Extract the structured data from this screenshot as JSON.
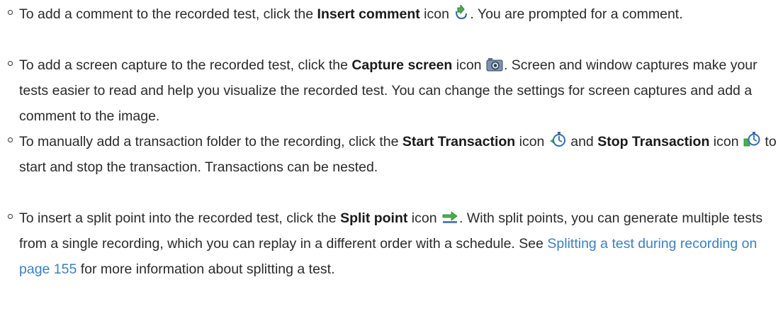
{
  "items": [
    {
      "pre": "To add a comment to the recorded test, click the ",
      "bold": "Insert comment",
      "mid": " icon",
      "icon": "insert-comment-icon",
      "post": ". You are prompted for a comment."
    },
    {
      "pre": "To add a screen capture to the recorded test, click the ",
      "bold": "Capture screen",
      "mid": " icon",
      "icon": "capture-screen-icon",
      "post": ". Screen and window captures make your tests easier to read and help you visualize the recorded test. You can change the settings for screen captures and add a comment to the image."
    },
    {
      "pre": "To manually add a transaction folder to the recording, click the ",
      "bold": "Start Transaction",
      "mid": " icon",
      "icon": "start-transaction-icon",
      "and": " and ",
      "bold2": "Stop Transaction",
      "mid2": " icon",
      "icon2": "stop-transaction-icon",
      "post": " to start and stop the transaction. Transactions can be nested."
    },
    {
      "pre": "To insert a split point into the recorded test, click the ",
      "bold": "Split point",
      "mid": " icon",
      "icon": "split-point-icon",
      "post": ". With split points, you can generate multiple tests from a single recording, which you can replay in a different order with a schedule. See ",
      "link": "Splitting a test during recording on page 155",
      "post2": " for more information about splitting a test."
    }
  ]
}
